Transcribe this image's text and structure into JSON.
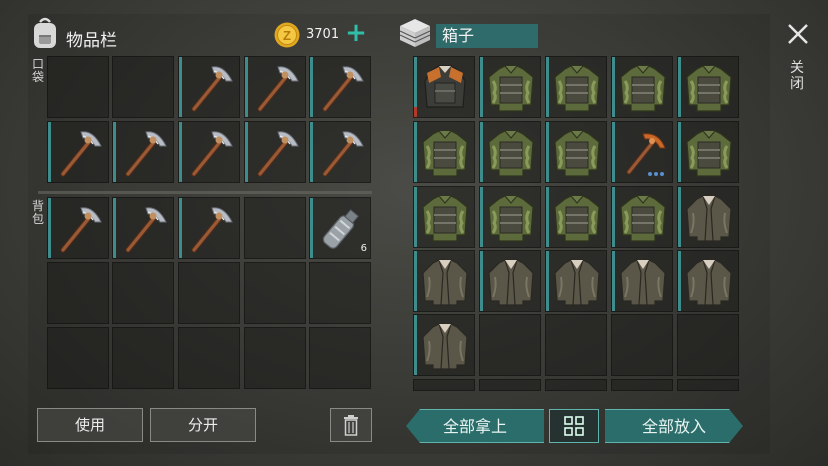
{
  "inventory": {
    "title": "物品栏",
    "coins": "3701",
    "pocket_label": "口袋",
    "backpack_label": "背包",
    "pocket_slots": [
      {
        "item": "empty"
      },
      {
        "item": "empty"
      },
      {
        "item": "pickaxe"
      },
      {
        "item": "pickaxe"
      },
      {
        "item": "pickaxe"
      },
      {
        "item": "pickaxe"
      },
      {
        "item": "pickaxe"
      },
      {
        "item": "pickaxe"
      },
      {
        "item": "pickaxe"
      },
      {
        "item": "pickaxe"
      }
    ],
    "backpack_slots": [
      {
        "item": "pickaxe"
      },
      {
        "item": "pickaxe"
      },
      {
        "item": "pickaxe"
      },
      {
        "item": "empty"
      },
      {
        "item": "water-bottle",
        "qty": "6"
      },
      {
        "item": "empty"
      },
      {
        "item": "empty"
      },
      {
        "item": "empty"
      },
      {
        "item": "empty"
      },
      {
        "item": "empty"
      },
      {
        "item": "empty"
      },
      {
        "item": "empty"
      },
      {
        "item": "empty"
      },
      {
        "item": "empty"
      },
      {
        "item": "empty"
      }
    ],
    "use_label": "使用",
    "split_label": "分开"
  },
  "container": {
    "title": "箱子",
    "close_label": "关闭",
    "slots": [
      {
        "item": "scrap-vest"
      },
      {
        "item": "camo-jacket"
      },
      {
        "item": "camo-jacket"
      },
      {
        "item": "camo-jacket"
      },
      {
        "item": "camo-jacket"
      },
      {
        "item": "camo-jacket"
      },
      {
        "item": "camo-jacket"
      },
      {
        "item": "camo-jacket"
      },
      {
        "item": "copper-pickaxe"
      },
      {
        "item": "camo-jacket"
      },
      {
        "item": "camo-jacket"
      },
      {
        "item": "camo-jacket"
      },
      {
        "item": "camo-jacket"
      },
      {
        "item": "camo-jacket"
      },
      {
        "item": "leather-jacket"
      },
      {
        "item": "leather-jacket"
      },
      {
        "item": "leather-jacket"
      },
      {
        "item": "leather-jacket"
      },
      {
        "item": "leather-jacket"
      },
      {
        "item": "leather-jacket"
      },
      {
        "item": "leather-jacket"
      },
      {
        "item": "empty"
      },
      {
        "item": "empty"
      },
      {
        "item": "empty"
      },
      {
        "item": "empty"
      }
    ],
    "take_all_label": "全部拿上",
    "put_all_label": "全部放入"
  },
  "colors": {
    "accent_teal": "#2f6b6a",
    "coin_gold": "#e0a820",
    "durability_red": "#b23a2b"
  }
}
